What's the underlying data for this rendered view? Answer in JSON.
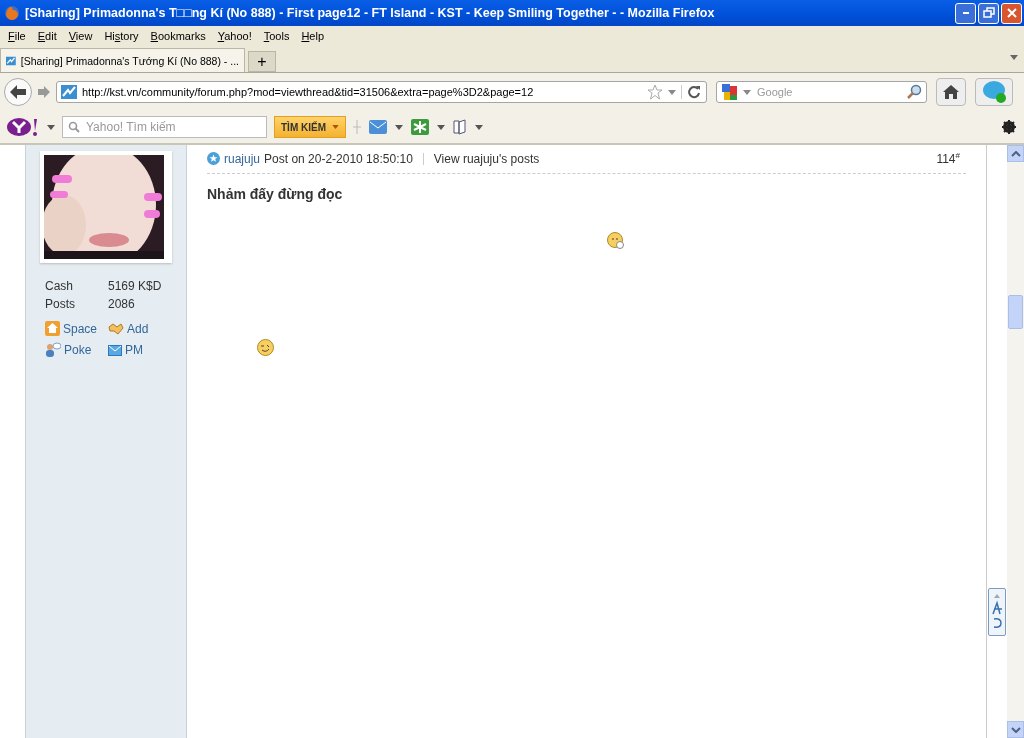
{
  "window": {
    "title": "[Sharing] Primadonna's T□□ng Kí (No 888) - First page12 - FT Island - KST - Keep Smiling Together - - Mozilla Firefox"
  },
  "menu": [
    "File",
    "Edit",
    "View",
    "History",
    "Bookmarks",
    "Yahoo!",
    "Tools",
    "Help"
  ],
  "tabs": [
    {
      "label": "[Sharing] Primadonna's Tướng Kí (No 888) - ...",
      "selected": true
    }
  ],
  "new_tab": "+",
  "address": {
    "value": "http://kst.vn/community/forum.php?mod=viewthread&tid=31506&extra=page%3D2&page=12"
  },
  "search": {
    "placeholder": "Google"
  },
  "yahoo_toolbar": {
    "search_placeholder": "Yahoo! Tìm kiếm",
    "search_button": "TÌM KIẾM"
  },
  "profile": {
    "stats": [
      {
        "label": "Cash",
        "value": "5169 K$D"
      },
      {
        "label": "Posts",
        "value": "2086"
      }
    ],
    "links": [
      {
        "kind": "space",
        "label": "Space"
      },
      {
        "kind": "add",
        "label": "Add"
      },
      {
        "kind": "poke",
        "label": "Poke"
      },
      {
        "kind": "pm",
        "label": "PM"
      }
    ]
  },
  "post": {
    "author": "ruajuju",
    "posted": "Post on 20-2-2010 18:50:10",
    "view_posts": "View ruajuju's posts",
    "number": "114",
    "number_mark": "#",
    "title": "Nhảm đấy đừng đọc"
  }
}
